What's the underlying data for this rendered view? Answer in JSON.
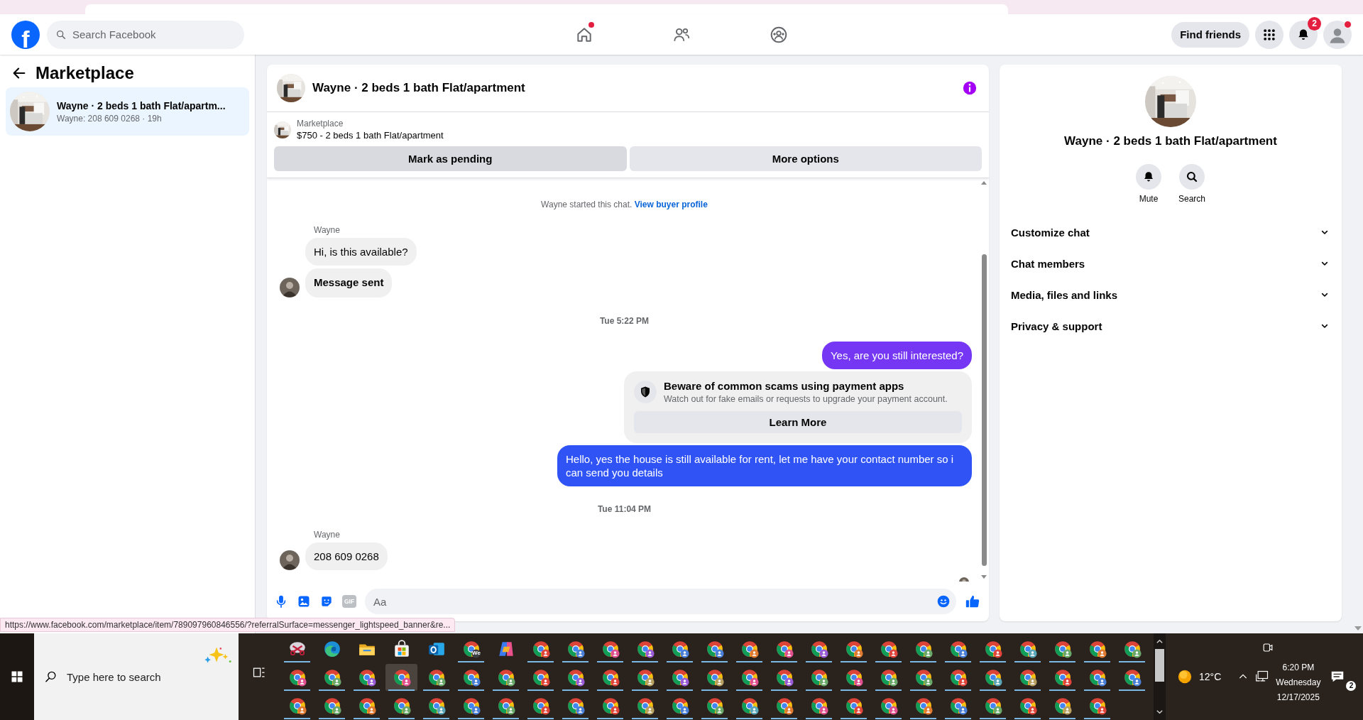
{
  "header": {
    "logo": "f",
    "search": {
      "placeholder": "Search Facebook"
    },
    "nav": [
      {
        "kind": "home",
        "dot": true
      },
      {
        "kind": "friends",
        "dot": false
      },
      {
        "kind": "groups",
        "dot": false
      }
    ],
    "find_friends": "Find friends",
    "notifications_count": "2",
    "profile_dot": true
  },
  "sidebar": {
    "title": "Marketplace",
    "conversations": [
      {
        "title": "Wayne · 2 beds 1 bath Flat/apartm...",
        "subtitle": "Wayne: 208 609 0268 · 19h",
        "selected": true
      }
    ]
  },
  "chat": {
    "title": "Wayne · 2 beds 1 bath Flat/apartment",
    "listing": {
      "label": "Marketplace",
      "summary": "$750 - 2 beds 1 bath Flat/apartment"
    },
    "actions": [
      {
        "label": "Mark as pending",
        "kind": "primary"
      },
      {
        "label": "More options",
        "kind": "secondary"
      }
    ],
    "messages": [
      {
        "kind": "system",
        "text": "Wayne started this chat.",
        "link": "View buyer profile"
      },
      {
        "kind": "sender",
        "text": "Wayne"
      },
      {
        "kind": "incoming",
        "text": "Hi, is this available?",
        "avatar": false
      },
      {
        "kind": "status",
        "text": "Message sent",
        "avatar": true
      },
      {
        "kind": "time",
        "text": "Tue 5:22 PM"
      },
      {
        "kind": "outgoing",
        "text": "Yes, are you still interested?",
        "color": "#7637f4"
      },
      {
        "kind": "notice",
        "title": "Beware of common scams using payment apps",
        "text": "Watch out for fake emails or requests to upgrade your payment account.",
        "button": "Learn More"
      },
      {
        "kind": "outgoing",
        "text": "Hello, yes the house is still available for rent, let me have your contact number so i can send you details",
        "color": "#3053f5"
      },
      {
        "kind": "time",
        "text": "Tue 11:04 PM"
      },
      {
        "kind": "sender",
        "text": "Wayne"
      },
      {
        "kind": "incoming",
        "text": "208 609 0268",
        "avatar": true
      },
      {
        "kind": "receipt"
      }
    ],
    "composer": {
      "gif_label": "GIF",
      "placeholder": "Aa"
    }
  },
  "details": {
    "title": "Wayne · 2 beds 1 bath Flat/apartment",
    "actions": [
      {
        "kind": "mute",
        "label": "Mute"
      },
      {
        "kind": "search",
        "label": "Search"
      }
    ],
    "sections": [
      {
        "label": "Customize chat",
        "expanded": false
      },
      {
        "label": "Chat members",
        "expanded": false
      },
      {
        "label": "Media, files and links",
        "expanded": false
      },
      {
        "label": "Privacy & support",
        "expanded": false
      }
    ]
  },
  "status_url": "https://www.facebook.com/marketplace/item/789097960846556/?referralSurface=messenger_lightspeed_banner&re...",
  "taskbar": {
    "search": {
      "placeholder": "Type here to search"
    },
    "apps": [
      {
        "kind": "snip",
        "running": true,
        "selected": false
      },
      {
        "kind": "edge",
        "running": false,
        "selected": false
      },
      {
        "kind": "explorer",
        "running": false,
        "selected": false
      },
      {
        "kind": "store",
        "running": false,
        "selected": false
      },
      {
        "kind": "outlook",
        "running": false,
        "selected": false
      },
      {
        "kind": "chrome",
        "badge": "We",
        "color": "#3c4043",
        "running": true,
        "selected": false
      },
      {
        "kind": "copilot",
        "running": false,
        "selected": false
      },
      {
        "kind": "chrome",
        "color": "#e0443a",
        "running": true,
        "selected": false
      },
      {
        "kind": "chrome",
        "color": "#4a7fd8",
        "running": true,
        "selected": false
      },
      {
        "kind": "chrome",
        "color": "#e0508f",
        "running": true,
        "selected": false
      },
      {
        "kind": "chrome",
        "color": "#9a5cd6",
        "running": true,
        "selected": false
      },
      {
        "kind": "chrome",
        "color": "#4a7fd8",
        "running": true,
        "selected": false
      },
      {
        "kind": "chrome",
        "color": "#4a7fd8",
        "running": true,
        "selected": false
      },
      {
        "kind": "chrome",
        "color": "#e07a30",
        "running": true,
        "selected": false
      },
      {
        "kind": "chrome",
        "color": "#e0508f",
        "running": true,
        "selected": false
      },
      {
        "kind": "chrome",
        "color": "#9a5cd6",
        "running": true,
        "selected": false
      },
      {
        "kind": "chrome",
        "color": "#e07a30",
        "running": true,
        "selected": false
      },
      {
        "kind": "chrome",
        "color": "#e0443a",
        "running": true,
        "selected": false
      },
      {
        "kind": "chrome",
        "color": "#6aa86a",
        "running": true,
        "selected": false
      },
      {
        "kind": "chrome",
        "color": "#4a7fd8",
        "running": true,
        "selected": false
      },
      {
        "kind": "chrome",
        "color": "#e0443a",
        "running": true,
        "selected": false
      },
      {
        "kind": "chrome",
        "color": "#5aa6b8",
        "running": true,
        "selected": false
      },
      {
        "kind": "chrome",
        "color": "#6aa86a",
        "running": true,
        "selected": false
      },
      {
        "kind": "chrome",
        "color": "#e07a30",
        "running": true,
        "selected": false
      },
      {
        "kind": "chrome",
        "color": "#6aa86a",
        "running": true,
        "selected": false
      },
      {
        "kind": "chrome",
        "color": "#e0508f",
        "running": true,
        "selected": false
      },
      {
        "kind": "chrome",
        "color": "#6aa86a",
        "running": true,
        "selected": false
      },
      {
        "kind": "chrome",
        "color": "#9a5cd6",
        "running": true,
        "selected": false
      },
      {
        "kind": "chrome",
        "color": "#e0508f",
        "running": true,
        "selected": true
      },
      {
        "kind": "chrome",
        "color": "#6aa86a",
        "running": true,
        "selected": false
      },
      {
        "kind": "chrome",
        "color": "#4a7fd8",
        "running": true,
        "selected": false
      },
      {
        "kind": "chrome",
        "color": "#6aa86a",
        "running": true,
        "selected": false
      },
      {
        "kind": "chrome",
        "color": "#e0443a",
        "running": true,
        "selected": false
      },
      {
        "kind": "chrome",
        "color": "#9a5cd6",
        "running": true,
        "selected": false
      },
      {
        "kind": "chrome",
        "color": "#e0443a",
        "running": true,
        "selected": false
      },
      {
        "kind": "chrome",
        "color": "#b8a060",
        "running": true,
        "selected": false
      },
      {
        "kind": "chrome",
        "color": "#9a5cd6",
        "running": true,
        "selected": false
      },
      {
        "kind": "chrome",
        "color": "#b8a060",
        "running": true,
        "selected": false
      },
      {
        "kind": "chrome",
        "color": "#e0508f",
        "running": true,
        "selected": false
      },
      {
        "kind": "chrome",
        "color": "#9a5cd6",
        "running": true,
        "selected": false
      },
      {
        "kind": "chrome",
        "color": "#6aa86a",
        "running": true,
        "selected": false
      },
      {
        "kind": "chrome",
        "color": "#e0508f",
        "running": true,
        "selected": false
      },
      {
        "kind": "chrome",
        "color": "#6aa86a",
        "running": true,
        "selected": false
      },
      {
        "kind": "chrome",
        "color": "#6aa86a",
        "running": true,
        "selected": false
      },
      {
        "kind": "chrome",
        "color": "#e0443a",
        "running": true,
        "selected": false
      },
      {
        "kind": "chrome",
        "color": "#5aa6b8",
        "running": true,
        "selected": false
      },
      {
        "kind": "chrome",
        "color": "#b8a060",
        "running": true,
        "selected": false
      },
      {
        "kind": "chrome",
        "color": "#e0443a",
        "running": true,
        "selected": false
      },
      {
        "kind": "chrome",
        "color": "#4a7fd8",
        "running": true,
        "selected": false
      },
      {
        "kind": "chrome",
        "color": "#4a7fd8",
        "running": true,
        "selected": false
      },
      {
        "kind": "chrome",
        "color": "#e07a30",
        "running": true,
        "selected": false
      },
      {
        "kind": "chrome",
        "color": "#6aa86a",
        "running": true,
        "selected": false
      },
      {
        "kind": "chrome",
        "color": "#e07a30",
        "running": true,
        "selected": false
      },
      {
        "kind": "chrome",
        "color": "#6aa86a",
        "running": true,
        "selected": false
      },
      {
        "kind": "chrome",
        "color": "#5aa6b8",
        "running": true,
        "selected": false
      },
      {
        "kind": "chrome",
        "color": "#4a7fd8",
        "running": true,
        "selected": false
      },
      {
        "kind": "chrome",
        "color": "#6aa86a",
        "running": true,
        "selected": false
      },
      {
        "kind": "chrome",
        "color": "#e0443a",
        "running": true,
        "selected": false
      },
      {
        "kind": "chrome",
        "color": "#4a7fd8",
        "running": true,
        "selected": false
      },
      {
        "kind": "chrome",
        "color": "#e0443a",
        "running": true,
        "selected": false
      },
      {
        "kind": "chrome",
        "color": "#b8a060",
        "running": true,
        "selected": false
      },
      {
        "kind": "chrome",
        "color": "#4a7fd8",
        "running": true,
        "selected": false
      },
      {
        "kind": "chrome",
        "color": "#6aa86a",
        "running": true,
        "selected": false
      },
      {
        "kind": "chrome",
        "color": "#5aa6b8",
        "running": true,
        "selected": false
      },
      {
        "kind": "chrome",
        "color": "#e07a30",
        "running": true,
        "selected": false
      },
      {
        "kind": "chrome",
        "color": "#e0508f",
        "running": true,
        "selected": false
      },
      {
        "kind": "chrome",
        "color": "#e0443a",
        "running": true,
        "selected": false
      },
      {
        "kind": "chrome",
        "color": "#e0508f",
        "running": true,
        "selected": false
      },
      {
        "kind": "chrome",
        "color": "#e07a30",
        "running": true,
        "selected": false
      },
      {
        "kind": "chrome",
        "color": "#4a7fd8",
        "running": true,
        "selected": false
      },
      {
        "kind": "chrome",
        "color": "#6aa86a",
        "running": true,
        "selected": false
      },
      {
        "kind": "chrome",
        "color": "#e0443a",
        "running": true,
        "selected": false
      },
      {
        "kind": "chrome",
        "color": "#b8a060",
        "running": true,
        "selected": false
      },
      {
        "kind": "chrome",
        "color": "#e0443a",
        "running": true,
        "selected": false
      }
    ],
    "tray": {
      "temperature": "12°C",
      "time": "6:20 PM",
      "day": "Wednesday",
      "date": "12/17/2025",
      "notifications": "2"
    }
  }
}
